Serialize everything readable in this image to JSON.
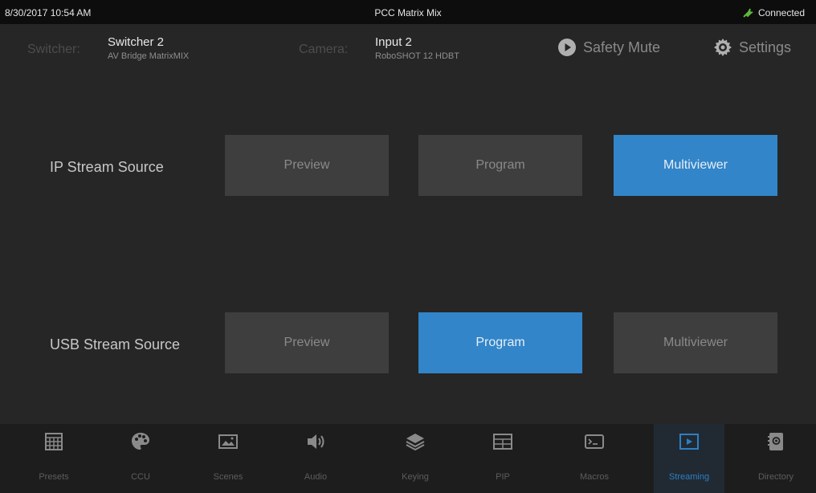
{
  "status": {
    "datetime": "8/30/2017 10:54 AM",
    "app_title": "PCC Matrix Mix",
    "connection": "Connected",
    "connection_color": "#5cba3c"
  },
  "header": {
    "switcher_label": "Switcher:",
    "switcher_name": "Switcher 2",
    "switcher_model": "AV Bridge MatrixMIX",
    "camera_label": "Camera:",
    "camera_name": "Input 2",
    "camera_model": "RoboSHOT 12 HDBT",
    "safety_mute": "Safety Mute",
    "settings": "Settings"
  },
  "ip_stream": {
    "label": "IP Stream Source",
    "options": [
      "Preview",
      "Program",
      "Multiviewer"
    ],
    "selected": "Multiviewer"
  },
  "usb_stream": {
    "label": "USB Stream Source",
    "options": [
      "Preview",
      "Program",
      "Multiviewer"
    ],
    "selected": "Program"
  },
  "tabs": [
    {
      "label": "Presets",
      "icon": "grid-icon"
    },
    {
      "label": "CCU",
      "icon": "palette-icon"
    },
    {
      "label": "Scenes",
      "icon": "picture-icon"
    },
    {
      "label": "Audio",
      "icon": "speaker-icon"
    },
    {
      "label": "Keying",
      "icon": "layers-icon"
    },
    {
      "label": "PIP",
      "icon": "pip-icon"
    },
    {
      "label": "Macros",
      "icon": "terminal-icon"
    },
    {
      "label": "Streaming",
      "icon": "play-icon"
    },
    {
      "label": "Directory",
      "icon": "address-book-icon"
    }
  ],
  "active_tab": "Streaming",
  "colors": {
    "accent": "#3285c8",
    "button": "#3e3e3e",
    "background": "#262626"
  }
}
